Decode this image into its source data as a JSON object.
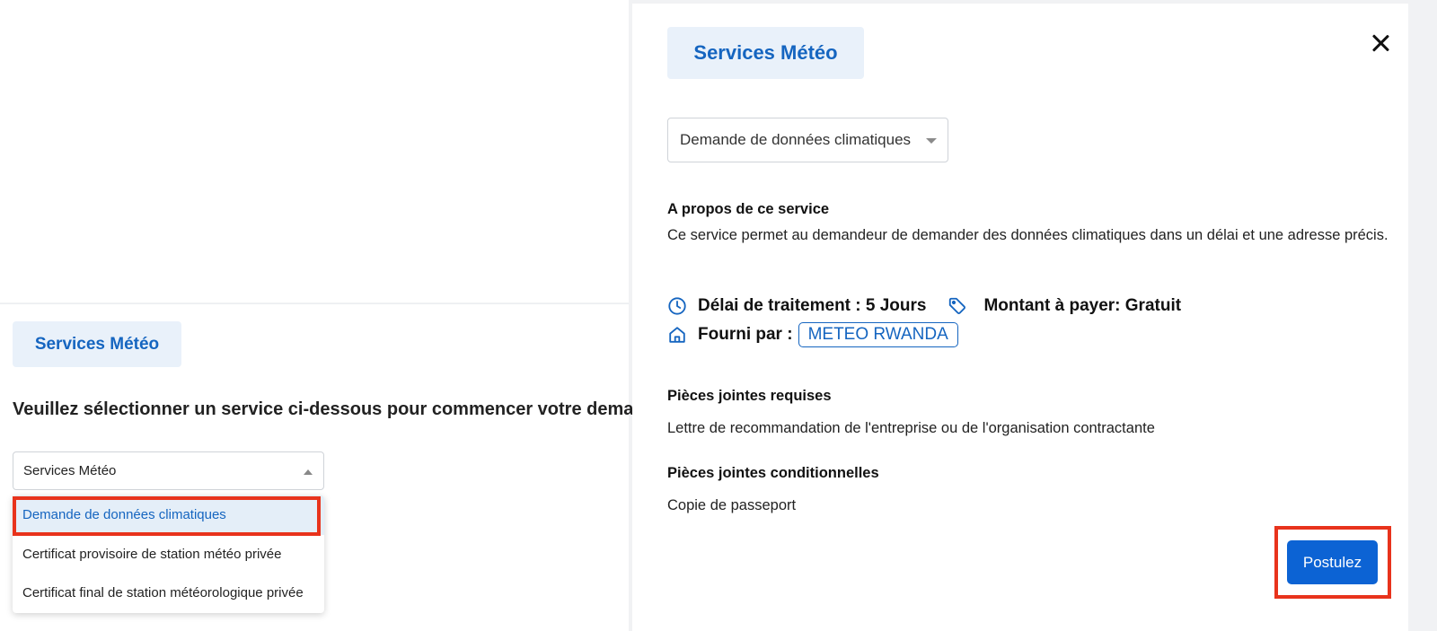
{
  "left": {
    "chip_label": "Services Météo",
    "heading": "Veuillez sélectionner un service ci-dessous pour commencer votre demande",
    "select_value": "Services Météo",
    "dropdown_options": [
      "Demande de données climatiques",
      "Certificat provisoire de station météo privée",
      "Certificat final de station météorologique privée"
    ],
    "selected_option_index": 0
  },
  "right": {
    "chip_label": "Services Météo",
    "service_select_value": "Demande de données climatiques",
    "about_title": "A propos de ce service",
    "about_text": "Ce service permet au demandeur de demander des données climatiques dans un délai et une adresse précis.",
    "processing_time": "Délai de traitement : 5 Jours",
    "price": "Montant à payer: Gratuit",
    "provided_by_label": "Fourni par :",
    "provider": "METEO RWANDA",
    "required_attachments_title": "Pièces jointes requises",
    "required_attachments": "Lettre de recommandation de l'entreprise ou de l'organisation contractante",
    "conditional_attachments_title": "Pièces jointes conditionnelles",
    "conditional_attachments": "Copie de passeport",
    "apply_label": "Postulez"
  },
  "icons": {
    "clock": "clock-icon",
    "tag": "tag-icon",
    "home": "home-icon",
    "close": "close-icon"
  },
  "colors": {
    "accent": "#1565c0",
    "chip_bg": "#e9f1fa",
    "button": "#0c63d4",
    "highlight": "#e8331c"
  }
}
